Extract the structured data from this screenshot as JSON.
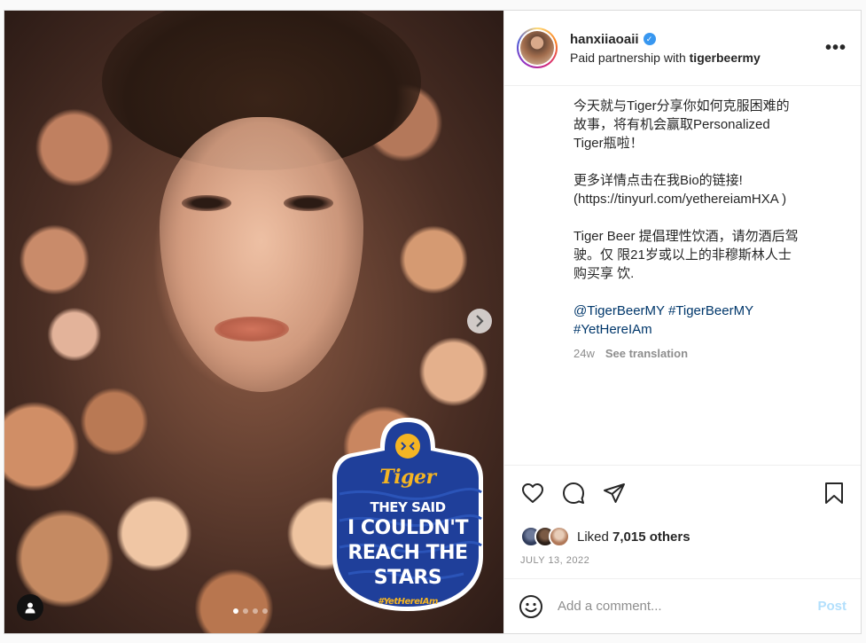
{
  "header": {
    "username": "hanxiiaoaii",
    "partner_prefix": "Paid partnership with",
    "partner_name": "tigerbeermy"
  },
  "caption": {
    "para1": "今天就与Tiger分享你如何克服困难的\n故事，将有机会赢取Personalized\nTiger瓶啦！",
    "para2": "更多详情点击在我Bio的链接!\n(https://tinyurl.com/yethereiamHXA )",
    "para3": "Tiger Beer 提倡理性饮酒，请勿酒后驾\n驶。仅 限21岁或以上的非穆斯林人士\n购买享 饮.",
    "tag1": "@TigerBeerMY",
    "tag2": "#TigerBeerMY",
    "tag3": "#YetHereIAm",
    "age": "24w",
    "see_translation": "See translation"
  },
  "media": {
    "badge_brand": "Tiger",
    "badge_line1": "THEY SAID",
    "badge_line2": "I COULDN'T",
    "badge_line3": "REACH THE",
    "badge_line4": "STARS",
    "badge_hashtag": "#YetHereIAm",
    "carousel_count": 4,
    "carousel_active": 1
  },
  "likes": {
    "prefix": "Liked",
    "count_text": "7,015 others"
  },
  "date": "JULY 13, 2022",
  "comment": {
    "placeholder": "Add a comment...",
    "post_label": "Post"
  },
  "colors": {
    "verified": "#3897f0",
    "link": "#00376b",
    "post_button": "#b2dffc",
    "badge_blue": "#1f3f9a",
    "badge_gold": "#f5b523"
  }
}
